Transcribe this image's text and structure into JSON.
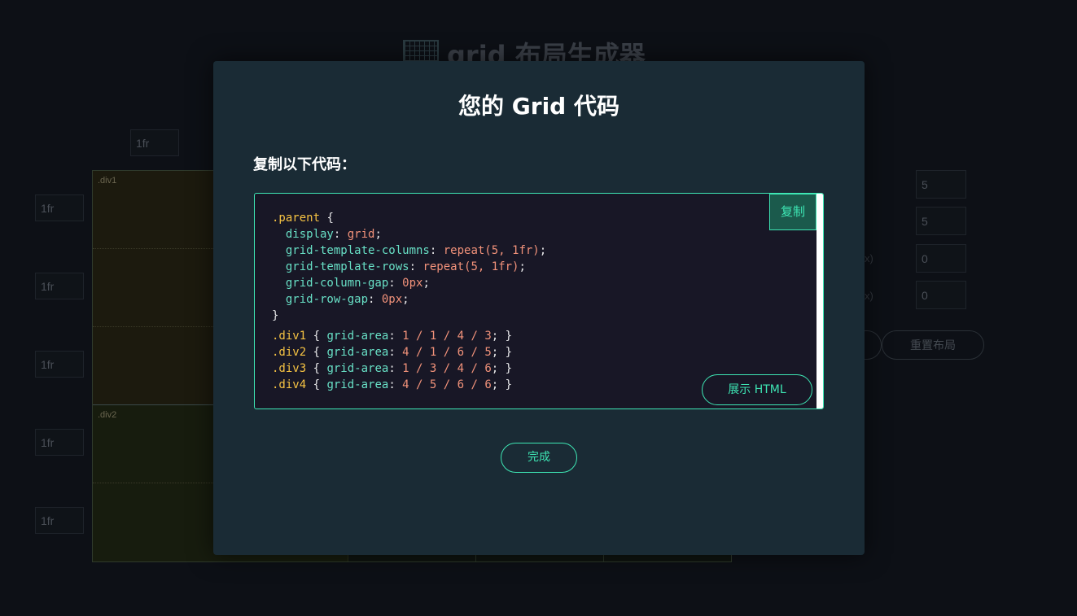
{
  "background": {
    "app_title": "grid 布局生成器",
    "column_input": "1fr",
    "row_inputs": [
      "1fr",
      "1fr",
      "1fr",
      "1fr",
      "1fr"
    ],
    "region_labels": [
      ".div1",
      ".div2"
    ],
    "settings": {
      "columns_value": "5",
      "rows_value": "5",
      "column_gap_value": "0",
      "row_gap_value": "0",
      "gap_unit_fragment": "x)",
      "reset_label": "重置布局"
    }
  },
  "modal": {
    "title": "您的 Grid 代码",
    "subtitle": "复制以下代码：",
    "copy_label": "复制",
    "show_html_label": "展示 HTML",
    "done_label": "完成",
    "code": {
      "parent_selector": ".parent",
      "open_brace": " {",
      "close_brace": "}",
      "properties": [
        {
          "prop": "display",
          "value": "grid"
        },
        {
          "prop": "grid-template-columns",
          "value": "repeat(5, 1fr)"
        },
        {
          "prop": "grid-template-rows",
          "value": "repeat(5, 1fr)"
        },
        {
          "prop": "grid-column-gap",
          "value": "0px"
        },
        {
          "prop": "grid-row-gap",
          "value": "0px"
        }
      ],
      "areas": [
        {
          "selector": ".div1",
          "prop": "grid-area",
          "value": "1 / 1 / 4 / 3"
        },
        {
          "selector": ".div2",
          "prop": "grid-area",
          "value": "4 / 1 / 6 / 5"
        },
        {
          "selector": ".div3",
          "prop": "grid-area",
          "value": "1 / 3 / 4 / 6"
        },
        {
          "selector": ".div4",
          "prop": "grid-area",
          "value": "4 / 5 / 6 / 6"
        }
      ]
    }
  },
  "colors": {
    "accent": "#3ee6b4",
    "modal_bg": "#1a2b35",
    "code_bg": "#181726",
    "selector": "#f6c343",
    "property": "#68e0c6",
    "value": "#f2927a"
  }
}
